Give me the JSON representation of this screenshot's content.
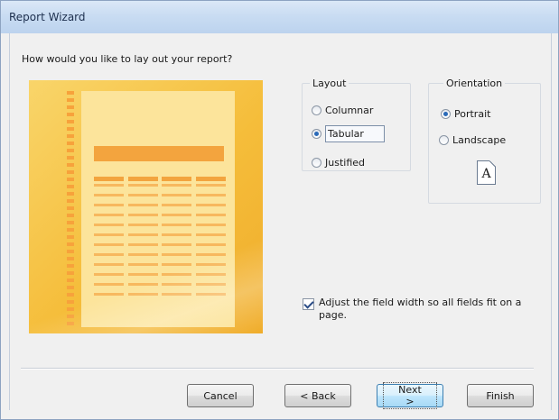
{
  "window": {
    "title": "Report Wizard"
  },
  "question": "How would you like to lay out your report?",
  "layout": {
    "legend": "Layout",
    "options": [
      "Columnar",
      "Tabular",
      "Justified"
    ],
    "selected": "Tabular"
  },
  "orientation": {
    "legend": "Orientation",
    "options": [
      "Portrait",
      "Landscape"
    ],
    "selected": "Portrait",
    "preview_letter": "A"
  },
  "fit_checkbox": {
    "label": "Adjust the field width so all fields fit on a page.",
    "checked": true
  },
  "buttons": {
    "cancel": "Cancel",
    "back": "< Back",
    "next": "Next >",
    "finish": "Finish"
  },
  "colors": {
    "preview_accent": "#f3a43e",
    "preview_background": "#f5bd3a"
  }
}
